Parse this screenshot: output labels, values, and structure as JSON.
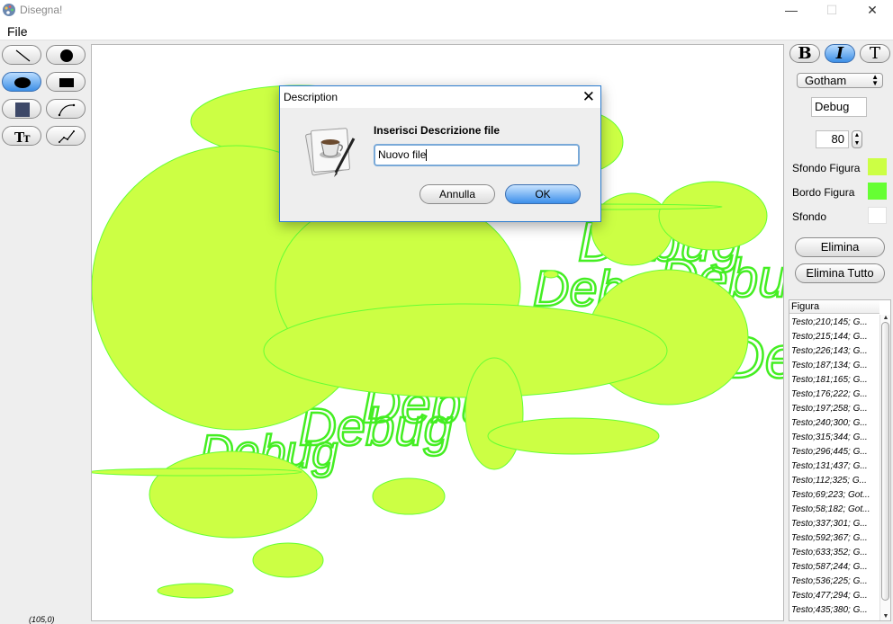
{
  "window": {
    "title": "Disegna!",
    "minimize_glyph": "—",
    "maximize_glyph": "☐",
    "close_glyph": "✕"
  },
  "menu": {
    "file": "File"
  },
  "tools": [
    {
      "name": "line-tool",
      "icon": "line-icon",
      "active": false
    },
    {
      "name": "filled-circle-tool",
      "icon": "filled-circle-icon",
      "active": false
    },
    {
      "name": "filled-ellipse-tool",
      "icon": "filled-ellipse-icon",
      "active": true
    },
    {
      "name": "filled-rectangle-tool",
      "icon": "filled-rectangle-icon",
      "active": false
    },
    {
      "name": "square-tool",
      "icon": "square-icon",
      "active": false
    },
    {
      "name": "curve-tool",
      "icon": "curve-icon",
      "active": false
    },
    {
      "name": "text-tool",
      "icon": "text-tool-icon",
      "active": false
    },
    {
      "name": "polyline-tool",
      "icon": "polyline-icon",
      "active": false
    }
  ],
  "status": {
    "coords": "(105,0)"
  },
  "canvas": {
    "shape_fill": "#ccff44",
    "shape_border": "#66ff33",
    "text_color": "#44ee22",
    "texts": [
      "Debug",
      "Debug",
      "Debug",
      "Debug",
      "Debug",
      "Debug",
      "Debug",
      "Debug"
    ]
  },
  "format": {
    "bold": "B",
    "italic": "I",
    "text": "T"
  },
  "font_select": {
    "value": "Gotham"
  },
  "text_input": {
    "value": "Debug"
  },
  "size_spinner": {
    "value": "80"
  },
  "properties": {
    "fill_label": "Sfondo Figura",
    "fill_color": "#ccff44",
    "border_label": "Bordo Figura",
    "border_color": "#66ff33",
    "background_label": "Sfondo",
    "background_color": "#ffffff"
  },
  "buttons": {
    "delete": "Elimina",
    "delete_all": "Elimina Tutto"
  },
  "list": {
    "header": "Figura",
    "rows": [
      "Testo;210;145; G...",
      "Testo;215;144; G...",
      "Testo;226;143; G...",
      "Testo;187;134; G...",
      "Testo;181;165; G...",
      "Testo;176;222; G...",
      "Testo;197;258; G...",
      "Testo;240;300; G...",
      "Testo;315;344; G...",
      "Testo;296;445; G...",
      "Testo;131;437; G...",
      "Testo;112;325; G...",
      "Testo;69;223; Got...",
      "Testo;58;182; Got...",
      "Testo;337;301; G...",
      "Testo;592;367; G...",
      "Testo;633;352; G...",
      "Testo;587;244; G...",
      "Testo;536;225; G...",
      "Testo;477;294; G...",
      "Testo;435;380; G..."
    ]
  },
  "dialog": {
    "title": "Description",
    "close_glyph": "✕",
    "message": "Inserisci Descrizione file",
    "input_value": "Nuovo file",
    "cancel": "Annulla",
    "ok": "OK",
    "icon": "coffee-cup-document-icon"
  }
}
